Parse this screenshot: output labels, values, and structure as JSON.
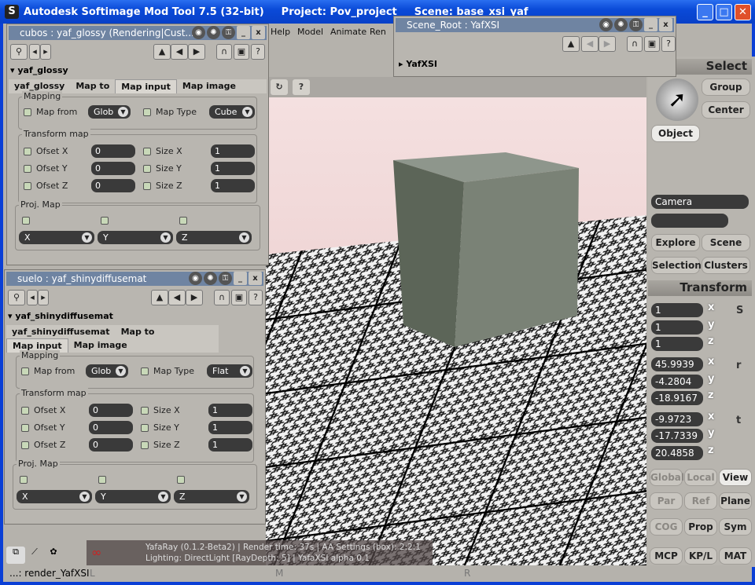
{
  "window": {
    "app_title": "Autodesk Softimage Mod Tool 7.5 (32-bit)",
    "project": "Project: Pov_project",
    "scene": "Scene: base_xsi_yaf",
    "minimize": "_",
    "maximize": "□",
    "close": "✕"
  },
  "menu": [
    "Help",
    "Model",
    "Animate",
    "Ren"
  ],
  "viewport": {
    "refresh": "↻",
    "help": "?"
  },
  "panel_cubos": {
    "title": "cubos : yaf_glossy (Rendering|Cust...",
    "section": "yaf_glossy",
    "tabs": [
      "yaf_glossy",
      "Map to",
      "Map input",
      "Map image"
    ],
    "active_tab": "Map input",
    "mapping_label": "Mapping",
    "map_from_label": "Map from",
    "map_from": "Glob",
    "map_type_label": "Map Type",
    "map_type": "Cube",
    "transform_label": "Transform map",
    "ofset_x_label": "Ofset X",
    "ofset_x": "0",
    "ofset_y_label": "Ofset Y",
    "ofset_y": "0",
    "ofset_z_label": "Ofset Z",
    "ofset_z": "0",
    "size_x_label": "Size X",
    "size_x": "1",
    "size_y_label": "Size Y",
    "size_y": "1",
    "size_z_label": "Size Z",
    "size_z": "1",
    "proj_label": "Proj. Map",
    "proj_x": "X",
    "proj_y": "Y",
    "proj_z": "Z"
  },
  "panel_suelo": {
    "title": "suelo : yaf_shinydiffusemat",
    "section": "yaf_shinydiffusemat",
    "tabs": [
      "yaf_shinydiffusemat",
      "Map to",
      "Map input",
      "Map image"
    ],
    "active_tab": "Map input",
    "mapping_label": "Mapping",
    "map_from_label": "Map from",
    "map_from": "Glob",
    "map_type_label": "Map Type",
    "map_type": "Flat",
    "transform_label": "Transform map",
    "ofset_x_label": "Ofset X",
    "ofset_x": "0",
    "ofset_y_label": "Ofset Y",
    "ofset_y": "0",
    "ofset_z_label": "Ofset Z",
    "ofset_z": "0",
    "size_x_label": "Size X",
    "size_x": "1",
    "size_y_label": "Size Y",
    "size_y": "1",
    "size_z_label": "Size Z",
    "size_z": "1",
    "proj_label": "Proj. Map",
    "proj_x": "X",
    "proj_y": "Y",
    "proj_z": "Z"
  },
  "panel_scene": {
    "title": "Scene_Root : YafXSI",
    "tree_item": "YafXSI"
  },
  "right": {
    "select": "Select",
    "group": "Group",
    "center": "Center",
    "object": "Object",
    "camera": "Camera",
    "explore": "Explore",
    "scene": "Scene",
    "selection": "Selection",
    "clusters": "Clusters",
    "transform": "Transform",
    "scale": [
      "1",
      "1",
      "1"
    ],
    "rotate": [
      "45.9939",
      "-4.2804",
      "-18.9167"
    ],
    "translate": [
      "-9.9723",
      "-17.7339",
      "20.4858"
    ],
    "axes": [
      "x",
      "y",
      "z"
    ],
    "s": "S",
    "r": "r",
    "t": "t",
    "global": "Global",
    "local": "Local",
    "view": "View",
    "par": "Par",
    "ref": "Ref",
    "plane": "Plane",
    "cog": "COG",
    "prop": "Prop",
    "sym": "Sym",
    "mcp": "MCP",
    "kpl": "KP/L",
    "mat": "MAT"
  },
  "render_info": {
    "line1": "YafaRay (0.1.2-Beta2) | Render time: 37s | AA Settings (box): 2:2:1",
    "line2": "Lighting: DirectLight [RayDepth: 5] | YafaXSI alpha 0.1",
    "logo": "YAFARAY"
  },
  "status": {
    "command": "...: render_YafXSI",
    "l": "L",
    "m": "M",
    "r": "R"
  }
}
